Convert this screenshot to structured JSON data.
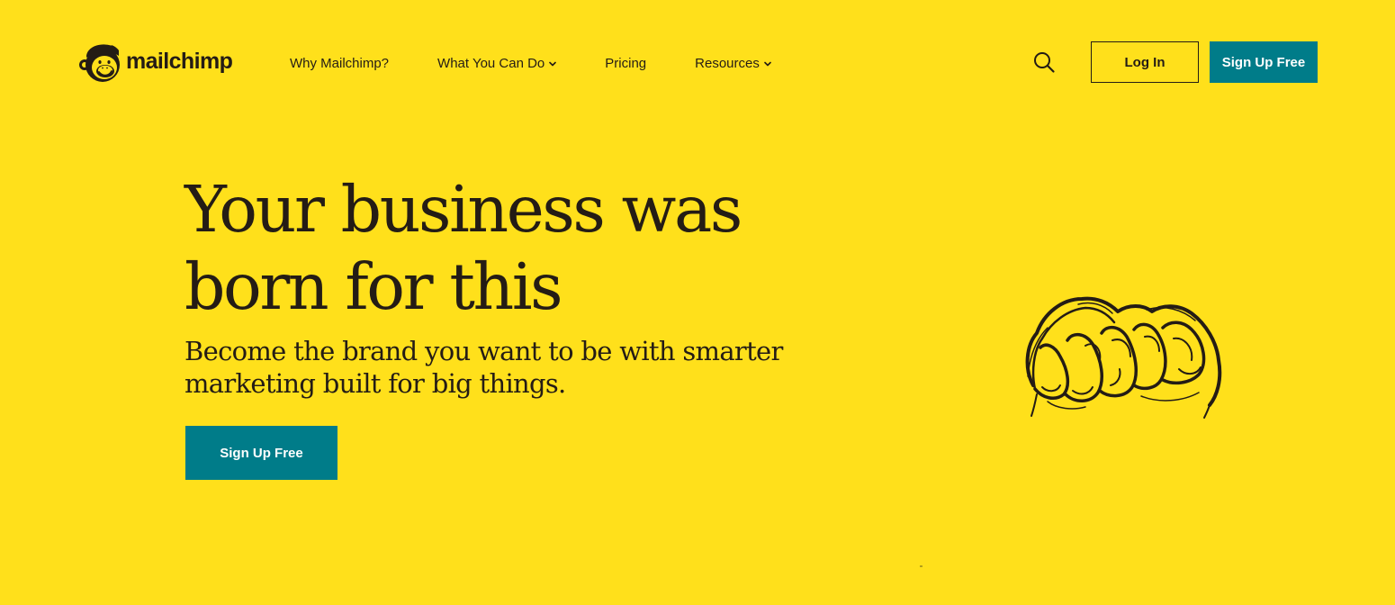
{
  "brand": {
    "name": "mailchimp",
    "logo_icon": "freddie-monkey-icon"
  },
  "nav": {
    "items": [
      {
        "label": "Why Mailchimp?",
        "has_dropdown": false
      },
      {
        "label": "What You Can Do",
        "has_dropdown": true
      },
      {
        "label": "Pricing",
        "has_dropdown": false
      },
      {
        "label": "Resources",
        "has_dropdown": true
      }
    ],
    "search_icon": "search-icon"
  },
  "header": {
    "login_label": "Log In",
    "signup_label": "Sign Up Free"
  },
  "hero": {
    "title_line1": "Your business was",
    "title_line2": "born for this",
    "subtitle_line1": "Become the brand you want to be with smarter",
    "subtitle_line2": "marketing built for big things.",
    "cta_label": "Sign Up Free",
    "illustration_icon": "hand-fist-illustration"
  },
  "colors": {
    "background": "#FFE01B",
    "text": "#241C15",
    "accent": "#007C89",
    "button_text": "#FFFFFF"
  }
}
